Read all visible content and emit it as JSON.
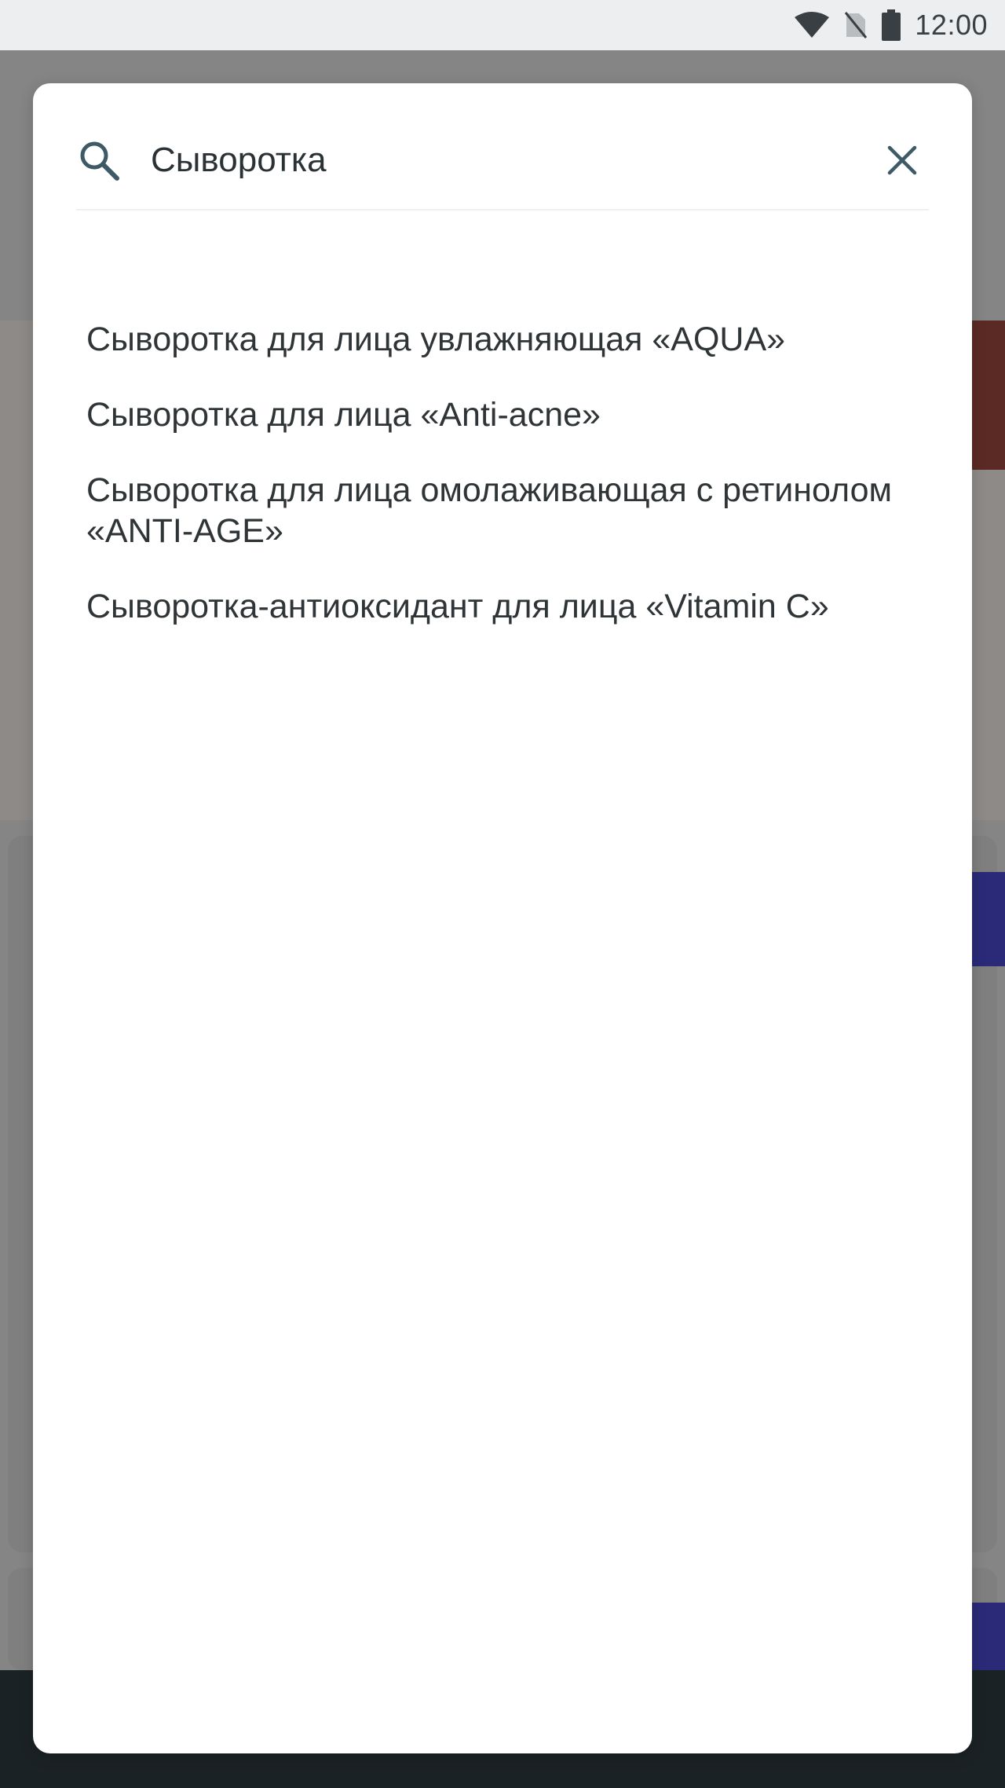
{
  "status_bar": {
    "time": "12:00",
    "icons": [
      "wifi-icon",
      "no-sim-icon",
      "battery-icon"
    ]
  },
  "search": {
    "query": "Сыворотка",
    "placeholder": "",
    "icon": "search-icon",
    "clear_icon": "close-icon"
  },
  "results": [
    "Сыворотка для лица увлажняющая «AQUA»",
    "Сыворотка для лица «Anti-acne»",
    "Сыворотка для лица омолаживающая с ретинолом «ANTI-AGE»",
    "Сыворотка-антиоксидант для лица «Vitamin C»"
  ],
  "colors": {
    "accent_icon": "#3d5a66",
    "text": "#2f3437",
    "status_bar_bg": "#eceeef",
    "scrim": "#858585"
  }
}
